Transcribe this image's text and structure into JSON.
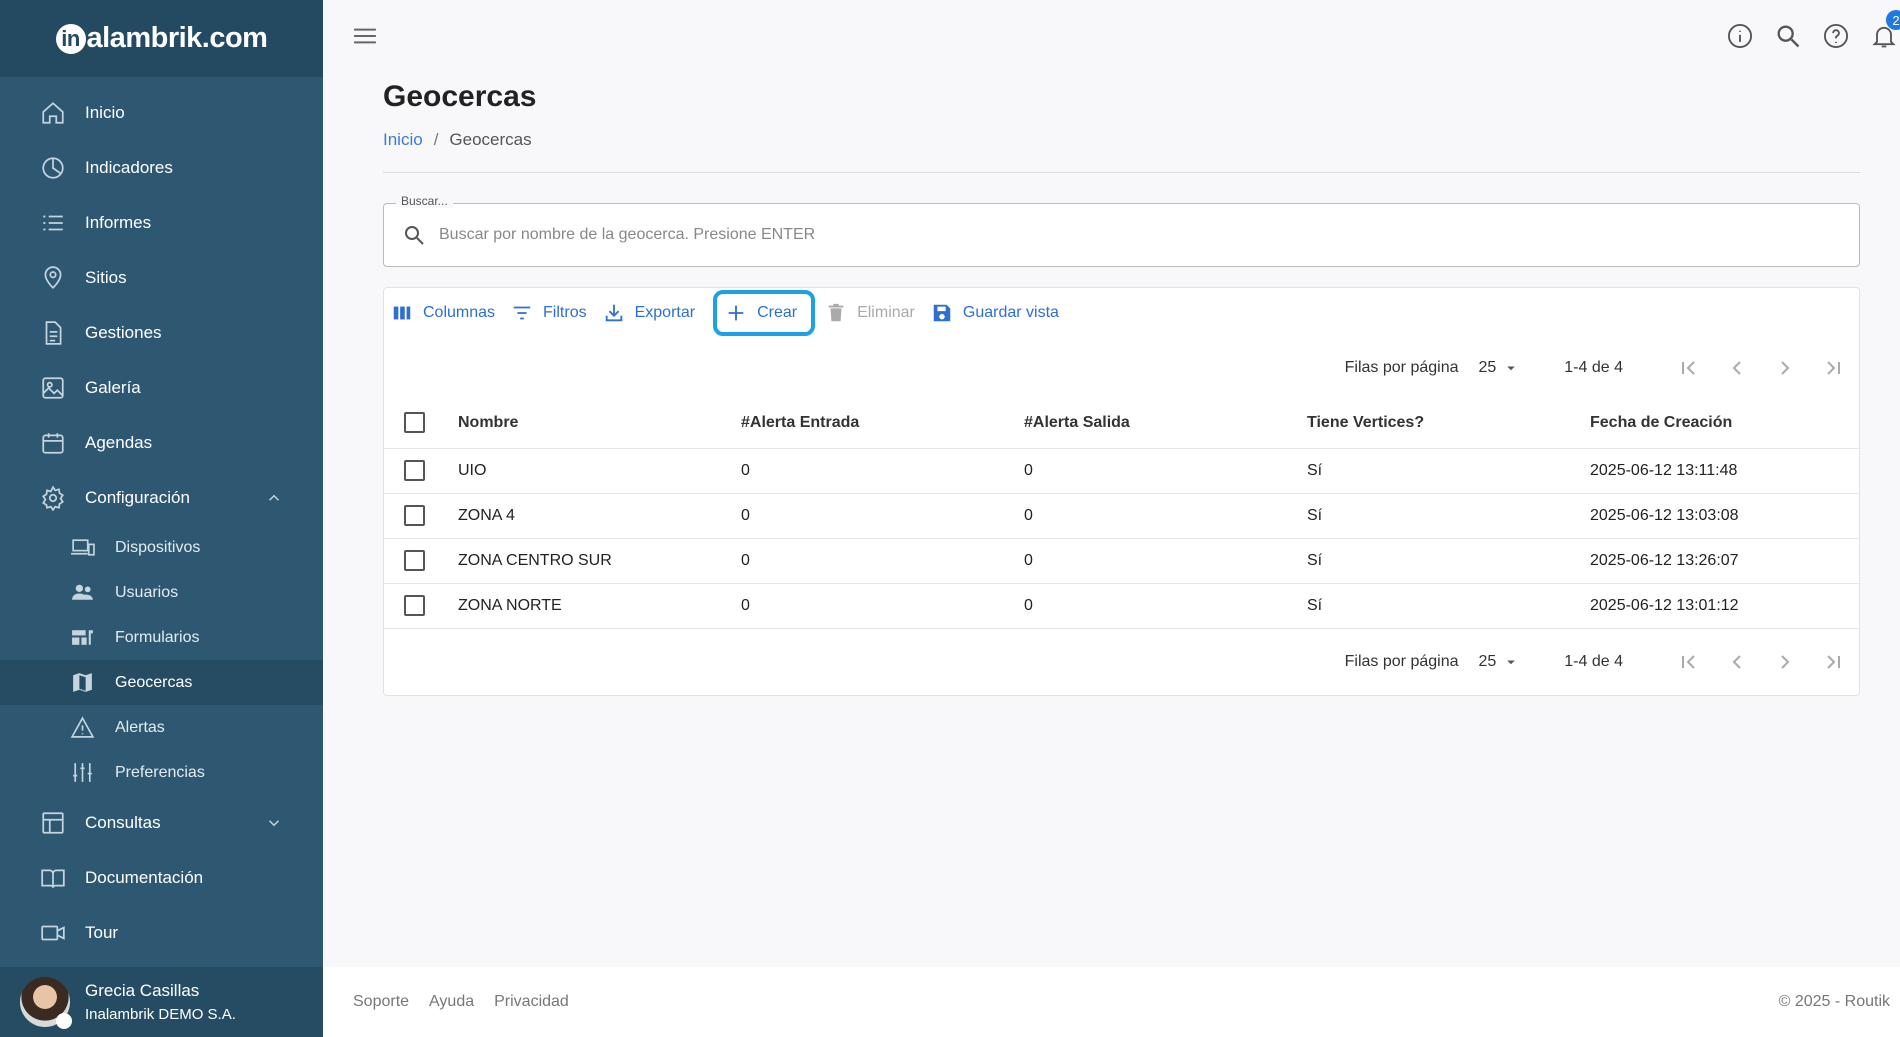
{
  "brand": {
    "name": "alambrik.com",
    "prefix": "in"
  },
  "sidebar": {
    "items": [
      {
        "label": "Inicio",
        "icon": "home-icon"
      },
      {
        "label": "Indicadores",
        "icon": "pie-chart-icon"
      },
      {
        "label": "Informes",
        "icon": "list-icon"
      },
      {
        "label": "Sitios",
        "icon": "map-pin-icon"
      },
      {
        "label": "Gestiones",
        "icon": "document-icon"
      },
      {
        "label": "Galería",
        "icon": "image-icon"
      },
      {
        "label": "Agendas",
        "icon": "calendar-icon"
      },
      {
        "label": "Configuración",
        "icon": "gear-icon",
        "expanded": true
      },
      {
        "label": "Consultas",
        "icon": "table-icon",
        "expanded": false
      },
      {
        "label": "Documentación",
        "icon": "book-icon"
      },
      {
        "label": "Tour",
        "icon": "video-icon"
      }
    ],
    "config_sub": [
      {
        "label": "Dispositivos",
        "icon": "devices-icon"
      },
      {
        "label": "Usuarios",
        "icon": "people-icon"
      },
      {
        "label": "Formularios",
        "icon": "form-icon"
      },
      {
        "label": "Geocercas",
        "icon": "map-icon",
        "active": true
      },
      {
        "label": "Alertas",
        "icon": "warning-icon"
      },
      {
        "label": "Preferencias",
        "icon": "sliders-icon"
      }
    ],
    "user": {
      "name": "Grecia Casillas",
      "org": "Inalambrik DEMO S.A."
    }
  },
  "topbar": {
    "notifications_count": "2"
  },
  "page": {
    "title": "Geocercas",
    "breadcrumb": {
      "home": "Inicio",
      "current": "Geocercas"
    }
  },
  "search": {
    "label": "Buscar...",
    "placeholder": "Buscar por nombre de la geocerca. Presione ENTER",
    "value": ""
  },
  "toolbar": {
    "columns": "Columnas",
    "filters": "Filtros",
    "export": "Exportar",
    "create": "Crear",
    "delete": "Eliminar",
    "save_view": "Guardar vista"
  },
  "pager": {
    "rows_per_page_label": "Filas por página",
    "rows_per_page": "25",
    "range": "1-4 de 4"
  },
  "table": {
    "headers": [
      "Nombre",
      "#Alerta Entrada",
      "#Alerta Salida",
      "Tiene Vertices?",
      "Fecha de Creación"
    ],
    "rows": [
      [
        "UIO",
        "0",
        "0",
        "Sí",
        "2025-06-12 13:11:48"
      ],
      [
        "ZONA 4",
        "0",
        "0",
        "Sí",
        "2025-06-12 13:03:08"
      ],
      [
        "ZONA CENTRO SUR",
        "0",
        "0",
        "Sí",
        "2025-06-12 13:26:07"
      ],
      [
        "ZONA NORTE",
        "0",
        "0",
        "Sí",
        "2025-06-12 13:01:12"
      ]
    ]
  },
  "footer": {
    "links": [
      "Soporte",
      "Ayuda",
      "Privacidad"
    ],
    "copyright": "© 2025 - Routik"
  }
}
